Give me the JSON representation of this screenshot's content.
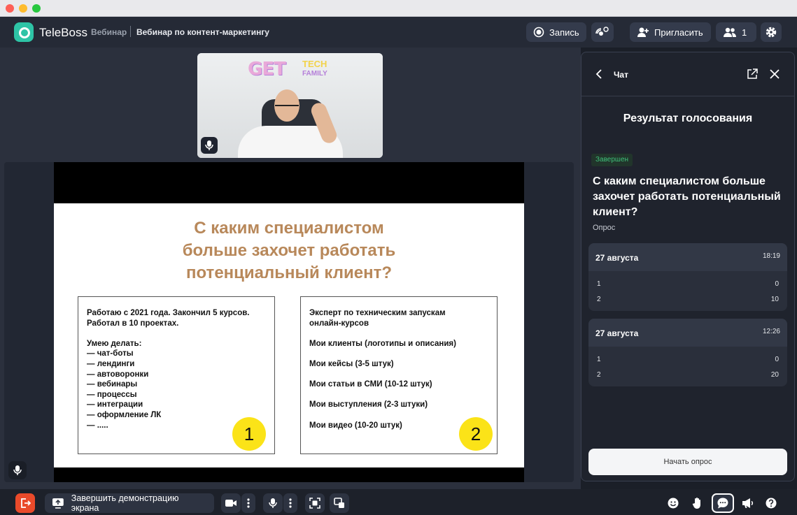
{
  "header": {
    "brand": "TeleBoss",
    "crumb_section": "Вебинар",
    "crumb_title": "Вебинар по контент-маркетингу",
    "record_label": "Запись",
    "invite_label": "Пригласить",
    "participants_count": "1"
  },
  "camera": {
    "sign_main": "GET",
    "sign_top": "TECH",
    "sign_bottom": "FAMILY"
  },
  "slide": {
    "title": "С каким специалистом\nбольше захочет работать\nпотенциальный клиент?",
    "box1_text": "Работаю с 2021 года. Закончил 5 курсов.\nРаботал в 10 проектах.\n\nУмею делать:\n— чат-боты\n— лендинги\n— автоворонки\n— вебинары\n— процессы\n— интеграции\n— оформление ЛК\n— .....",
    "box1_badge": "1",
    "box2_text": "Эксперт по техническим запускам\nонлайн-курсов\n\nМои клиенты (логотипы и описания)\n\nМои кейсы (3-5 штук)\n\nМои статьи в СМИ (10-12 штук)\n\nМои выступления (2-3 штуки)\n\nМои видео (10-20 штук)",
    "box2_badge": "2"
  },
  "panel": {
    "title": "Чат",
    "heading": "Результат голосования",
    "status": "Завершен",
    "question": "С каким специалистом больше захочет работать потенциальный клиент?",
    "type": "Опрос",
    "results": [
      {
        "date": "27 августа",
        "time": "18:19",
        "rows": [
          {
            "option": "1",
            "votes": "0"
          },
          {
            "option": "2",
            "votes": "10"
          }
        ]
      },
      {
        "date": "27 августа",
        "time": "12:26",
        "rows": [
          {
            "option": "1",
            "votes": "0"
          },
          {
            "option": "2",
            "votes": "20"
          }
        ]
      }
    ],
    "start_button": "Начать опрос"
  },
  "bottom": {
    "stop_share_label": "Завершить демонстрацию экрана"
  },
  "colors": {
    "accent": "#2ec4a6",
    "exit": "#ea4a2a",
    "slide_title": "#b8885a",
    "badge": "#fbe318",
    "status_green": "#3fc07a"
  }
}
